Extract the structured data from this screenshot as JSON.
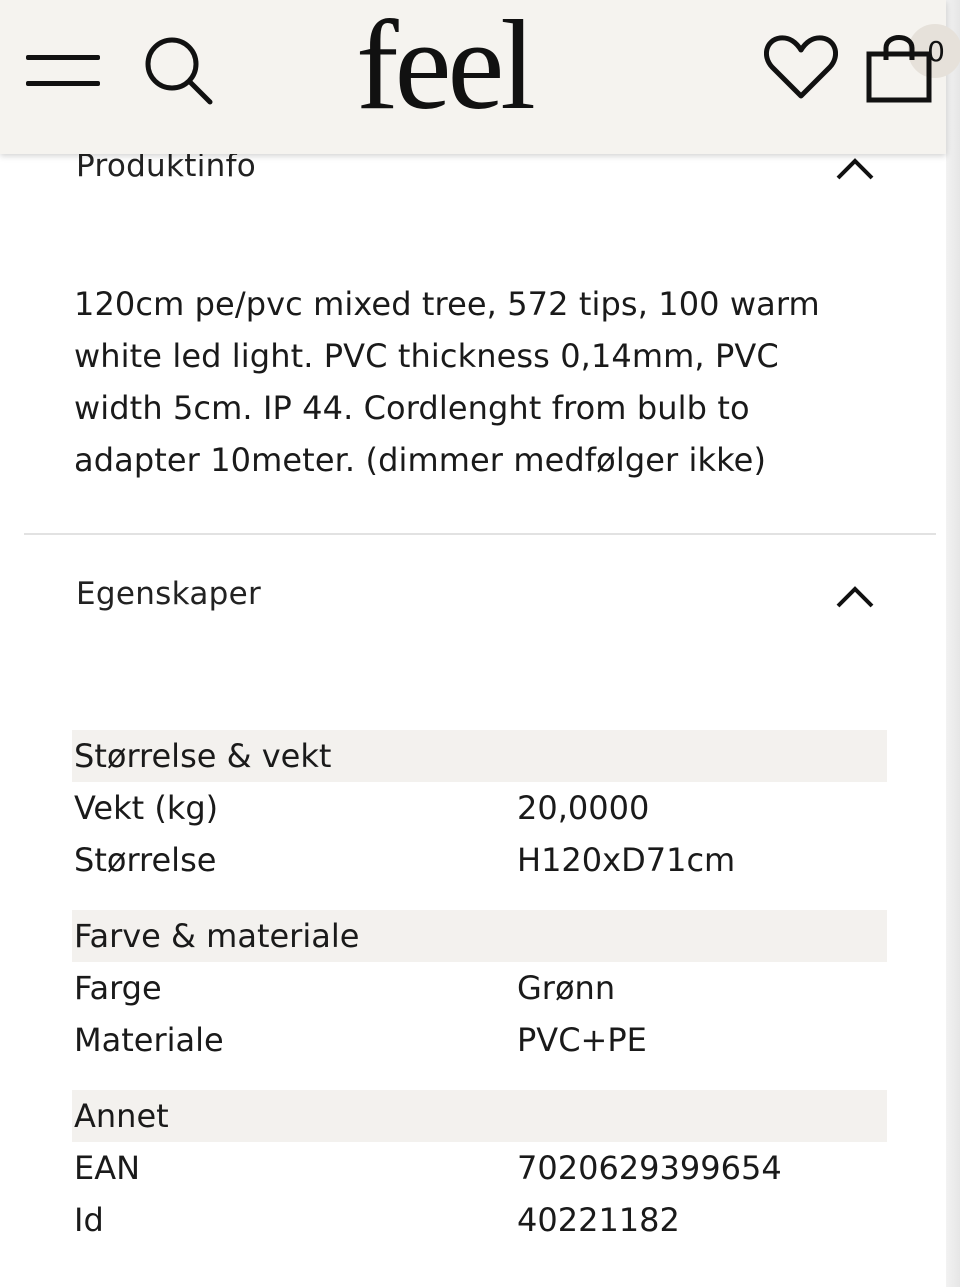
{
  "header": {
    "logo": "feel",
    "cart_count": "0"
  },
  "sections": {
    "product_info": {
      "title": "Produktinfo",
      "description": "120cm pe/pvc mixed tree, 572 tips, 100 warm white led light. PVC thickness 0,14mm, PVC width 5cm. IP 44. Cordlenght from bulb to adapter 10meter. (dimmer medfølger ikke)"
    },
    "properties": {
      "title": "Egenskaper",
      "groups": [
        {
          "heading": "Størrelse & vekt",
          "rows": [
            {
              "label": "Vekt (kg)",
              "value": "20,0000"
            },
            {
              "label": "Størrelse",
              "value": "H120xD71cm"
            }
          ]
        },
        {
          "heading": "Farve & materiale",
          "rows": [
            {
              "label": "Farge",
              "value": "Grønn"
            },
            {
              "label": "Materiale",
              "value": "PVC+PE"
            }
          ]
        },
        {
          "heading": "Annet",
          "rows": [
            {
              "label": "EAN",
              "value": "7020629399654"
            },
            {
              "label": "Id",
              "value": "40221182"
            }
          ]
        }
      ]
    }
  },
  "icons": {
    "menu": "hamburger-menu-icon",
    "search": "search-icon",
    "wishlist": "heart-icon",
    "cart": "shopping-bag-icon",
    "collapse": "chevron-up-icon"
  },
  "colors": {
    "header_bg": "#f5f3ef",
    "group_bg": "#f3f1ee",
    "text": "#1a1a1a",
    "divider": "#e2e2e2"
  }
}
